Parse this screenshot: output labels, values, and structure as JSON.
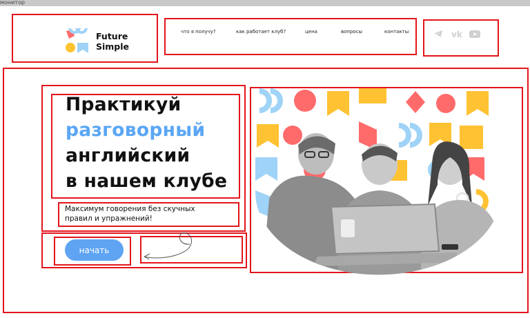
{
  "window": {
    "label": "монитор"
  },
  "logo": {
    "line1": "Future",
    "line2": "Simple"
  },
  "nav": {
    "items": [
      {
        "label": "что я получу?"
      },
      {
        "label": "как работает клуб?"
      },
      {
        "label": "цена"
      },
      {
        "label": "вопросы"
      },
      {
        "label": "контакты"
      }
    ]
  },
  "social": {
    "icons": [
      "telegram-icon",
      "vk-icon",
      "youtube-icon"
    ]
  },
  "hero": {
    "title_line1": "Практикуй",
    "title_line2": "разговорный",
    "title_line3": "английский",
    "title_line4": "в нашем клубе",
    "subtitle_line1": "Максимум говорения без скучных",
    "subtitle_line2": "правил и упражнений!",
    "cta_label": "начать"
  },
  "colors": {
    "accent": "#5aa6f5",
    "button": "#5ea4f3",
    "annotation": "#e3141b",
    "pattern_red": "#ff6b6b",
    "pattern_yellow": "#ffc233",
    "pattern_blue": "#9fd3f7"
  }
}
